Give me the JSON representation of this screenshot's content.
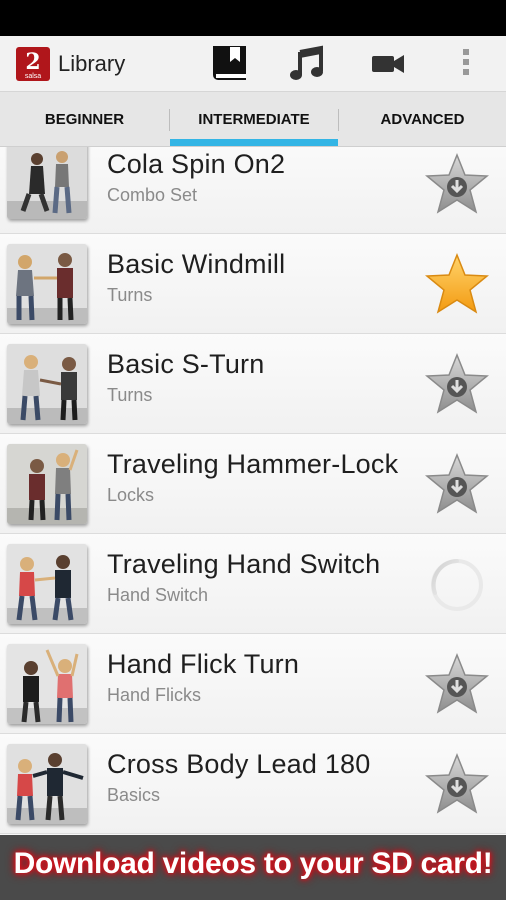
{
  "app": {
    "title": "Library",
    "logo_letter": "2",
    "logo_caption": "salsa"
  },
  "action_bar": {
    "icons": [
      "library-book-icon",
      "music-note-icon",
      "video-camera-icon",
      "overflow-menu-icon"
    ],
    "active_icon": "library-book-icon"
  },
  "tabs": [
    {
      "label": "BEGINNER",
      "selected": false
    },
    {
      "label": "INTERMEDIATE",
      "selected": true
    },
    {
      "label": "ADVANCED",
      "selected": false
    }
  ],
  "items": [
    {
      "title": "Cola Spin On2",
      "subtitle": "Combo Set",
      "status": "download-star-icon"
    },
    {
      "title": "Basic Windmill",
      "subtitle": "Turns",
      "status": "favorite-star-icon"
    },
    {
      "title": "Basic S-Turn",
      "subtitle": "Turns",
      "status": "download-star-icon"
    },
    {
      "title": "Traveling Hammer-Lock",
      "subtitle": "Locks",
      "status": "download-star-icon"
    },
    {
      "title": "Traveling Hand Switch",
      "subtitle": "Hand Switch",
      "status": "loading-spinner-icon"
    },
    {
      "title": "Hand Flick Turn",
      "subtitle": "Hand Flicks",
      "status": "download-star-icon"
    },
    {
      "title": "Cross Body Lead 180",
      "subtitle": "Basics",
      "status": "download-star-icon"
    }
  ],
  "banner": {
    "text": "Download videos to your SD card!"
  },
  "colors": {
    "accent": "#33b5e5",
    "star_active": "#f9a51e",
    "star_inactive": "#9e9e9e",
    "banner_glow": "#e0101a"
  }
}
